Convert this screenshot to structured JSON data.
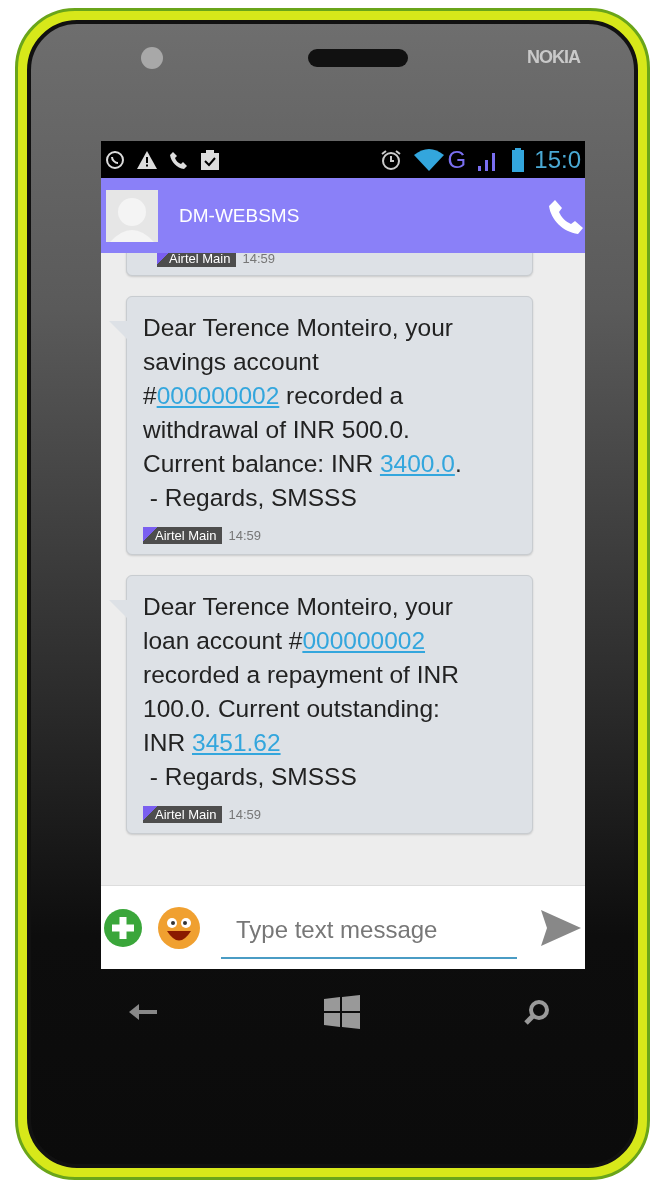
{
  "phone": {
    "brand": "NOKIA"
  },
  "status_bar": {
    "network": "G",
    "time": "15:0"
  },
  "header": {
    "contact": "DM-WEBSMS"
  },
  "messages": [
    {
      "sim": "Airtel Main",
      "time": "14:59"
    },
    {
      "lines": [
        [
          {
            "text": "Dear Terence Monteiro, your",
            "link": false
          }
        ],
        [
          {
            "text": "savings account",
            "link": false
          }
        ],
        [
          {
            "text": "#",
            "link": false
          },
          {
            "text": "000000002",
            "link": true
          },
          {
            "text": " recorded a",
            "link": false
          }
        ],
        [
          {
            "text": "withdrawal of INR 500.0.",
            "link": false
          }
        ],
        [
          {
            "text": "Current balance: INR ",
            "link": false
          },
          {
            "text": "3400.0",
            "link": true
          },
          {
            "text": ".",
            "link": false
          }
        ],
        [
          {
            "text": " - Regards, SMSSS",
            "link": false
          }
        ]
      ],
      "sim": "Airtel Main",
      "time": "14:59"
    },
    {
      "lines": [
        [
          {
            "text": "Dear Terence Monteiro, your",
            "link": false
          }
        ],
        [
          {
            "text": "loan account #",
            "link": false
          },
          {
            "text": "000000002",
            "link": true
          }
        ],
        [
          {
            "text": "recorded a repayment of INR",
            "link": false
          }
        ],
        [
          {
            "text": "100.0. Current outstanding:",
            "link": false
          }
        ],
        [
          {
            "text": "INR ",
            "link": false
          },
          {
            "text": "3451.62",
            "link": true
          }
        ],
        [
          {
            "text": " - Regards, SMSSS",
            "link": false
          }
        ]
      ],
      "sim": "Airtel Main",
      "time": "14:59"
    }
  ],
  "compose": {
    "placeholder": "Type text message"
  }
}
